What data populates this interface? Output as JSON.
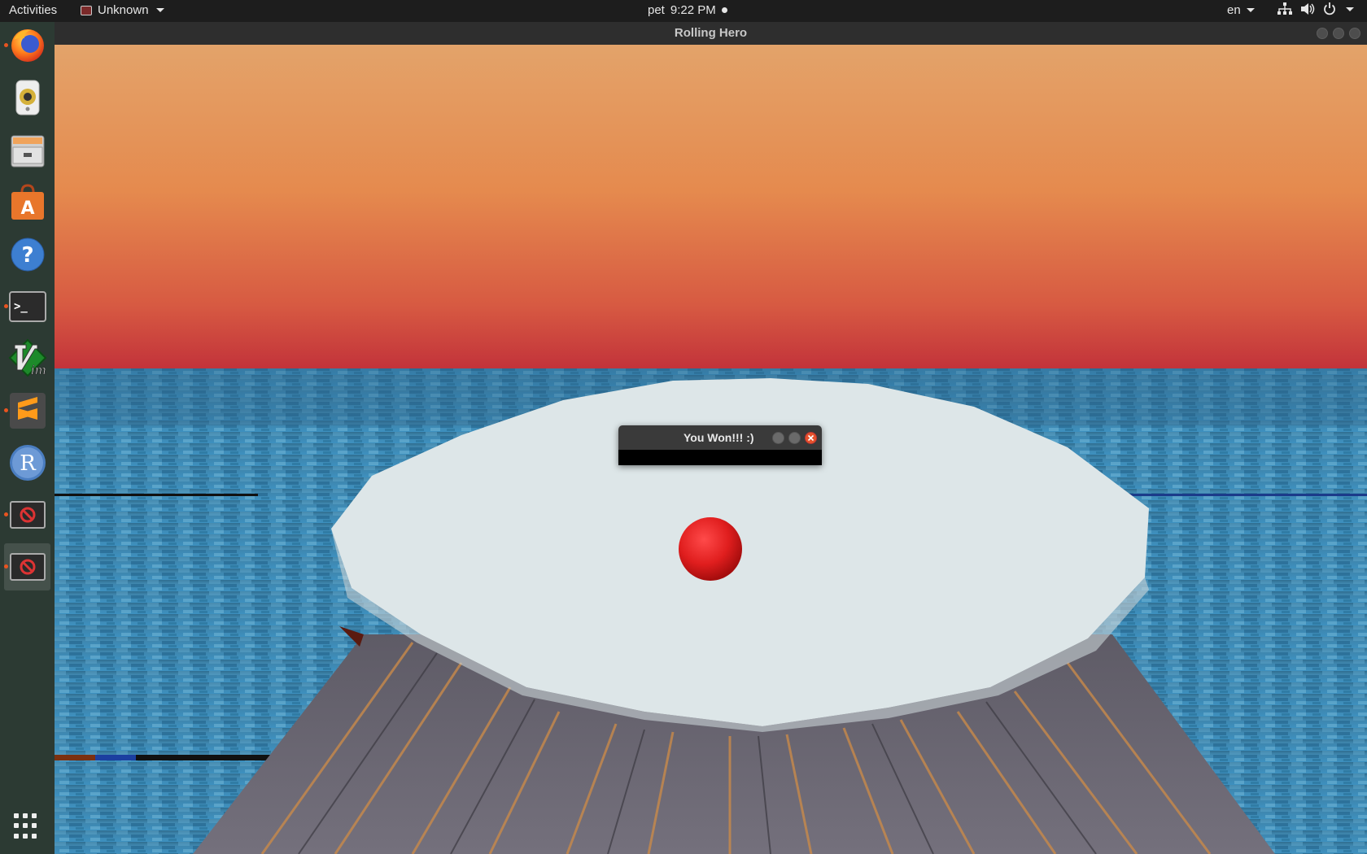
{
  "topbar": {
    "activities": "Activities",
    "app_menu": "Unknown",
    "clock_day": "pet",
    "clock_time": "9:22 PM",
    "language": "en"
  },
  "dock": {
    "items": [
      {
        "name": "firefox",
        "icon": "firefox-icon",
        "running": true
      },
      {
        "name": "rhythmbox",
        "icon": "speaker-icon",
        "running": false
      },
      {
        "name": "files",
        "icon": "file-cabinet-icon",
        "running": false
      },
      {
        "name": "software",
        "icon": "software-bag-icon",
        "running": false
      },
      {
        "name": "help",
        "icon": "help-icon",
        "running": false
      },
      {
        "name": "terminal",
        "icon": "terminal-icon",
        "running": true
      },
      {
        "name": "vim",
        "icon": "vim-icon",
        "running": false
      },
      {
        "name": "sublime",
        "icon": "sublime-icon",
        "running": true
      },
      {
        "name": "r",
        "icon": "r-icon",
        "running": false
      },
      {
        "name": "unknown-app-1",
        "icon": "blocked-app-icon",
        "running": true
      },
      {
        "name": "unknown-app-2",
        "icon": "blocked-app-icon",
        "running": true,
        "active": true
      }
    ],
    "show_apps_icon": "grid-icon",
    "r_glyph": "R",
    "help_glyph": "?",
    "terminal_glyph": ">_",
    "sublime_glyph": "S",
    "vim_glyph": "Vim"
  },
  "window": {
    "title": "Rolling Hero"
  },
  "dialog": {
    "title": "You Won!!! :)"
  },
  "colors": {
    "sky_top": "#e3a36a",
    "sky_bottom": "#c8383a",
    "sea": "#3f7fa3",
    "platform": "#dde6e8",
    "ball": "#e01e1e",
    "wood": "#6a6672",
    "accent": "#e95420"
  }
}
